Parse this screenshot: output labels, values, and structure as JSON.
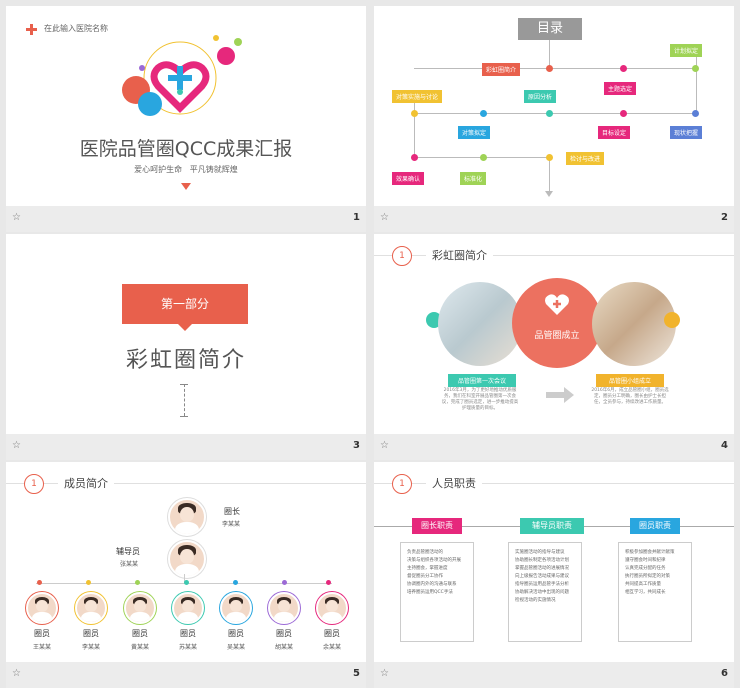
{
  "slides": [
    {
      "num": "1",
      "hospital": "在此输入医院名称",
      "title": "医院品管圈QCC成果汇报",
      "subtitle": "爱心呵护生命   平凡铸就辉煌"
    },
    {
      "num": "2",
      "title": "目录",
      "tags": [
        "彩虹圈简介",
        "主题选定",
        "计划拟定",
        "对策实施与讨论",
        "原因分析",
        "对策拟定",
        "目标设定",
        "现状把握",
        "效果确认",
        "标准化",
        "检讨与改进"
      ]
    },
    {
      "num": "3",
      "part": "第一部分",
      "heading": "彩虹圈简介"
    },
    {
      "num": "4",
      "badge": "1",
      "header": "彩虹圈简介",
      "center": "品管圈成立",
      "left_tag": "品管圈第一次会议",
      "left_text": "2016年3月，为了更好地推动优质服务，我们在科室开展品管圈第一次会议，完成了圈员选定，进一步推动提高护理质量的目标。",
      "right_tag": "品管圈小组成立",
      "right_text": "2016年6月，成立品管圈小组，圈员选定，圈员分工明确，圈长由护士长担任，全员参与，持续改进工作质量。"
    },
    {
      "num": "5",
      "badge": "1",
      "header": "成员简介",
      "leader": {
        "role": "圈长",
        "name": "李某某"
      },
      "assistant": {
        "role": "辅导员",
        "name": "张某某"
      },
      "members": [
        {
          "role": "圈员",
          "name": "王某某"
        },
        {
          "role": "圈员",
          "name": "李某某"
        },
        {
          "role": "圈员",
          "name": "黄某某"
        },
        {
          "role": "圈员",
          "name": "苏某某"
        },
        {
          "role": "圈员",
          "name": "吴某某"
        },
        {
          "role": "圈员",
          "name": "胡某某"
        },
        {
          "role": "圈员",
          "name": "余某某"
        }
      ]
    },
    {
      "num": "6",
      "badge": "1",
      "header": "人员职责",
      "duties": [
        {
          "title": "圈长职责",
          "color": "#e6287c",
          "lines": [
            "负责品管圈活动的",
            "决策与组织各项活动的开展",
            "主持圈会，掌握进度",
            "督促圈员分工协作",
            "协调圈内外的沟通与联系",
            "培养圈员运用QCC手法"
          ]
        },
        {
          "title": "辅导员职责",
          "color": "#3cc9b0",
          "lines": [
            "实施圈活动的指导与建议",
            "协助圈长制定各项活动计划",
            "掌握品管圈活动的进展情况",
            "向上级报告活动成果与建议",
            "指导圈员运用品管手法分析",
            "协助解决活动中出现的问题",
            "检视活动的实施情况"
          ]
        },
        {
          "title": "圈员职责",
          "color": "#29a6df",
          "lines": [
            "积极参加圈会并献计献策",
            "遵守圈会时间和纪律",
            "认真完成分配的任务",
            "执行圈员所拟定的对策",
            "共同提高工作质量",
            "相互学习，共同成长"
          ]
        }
      ]
    }
  ]
}
